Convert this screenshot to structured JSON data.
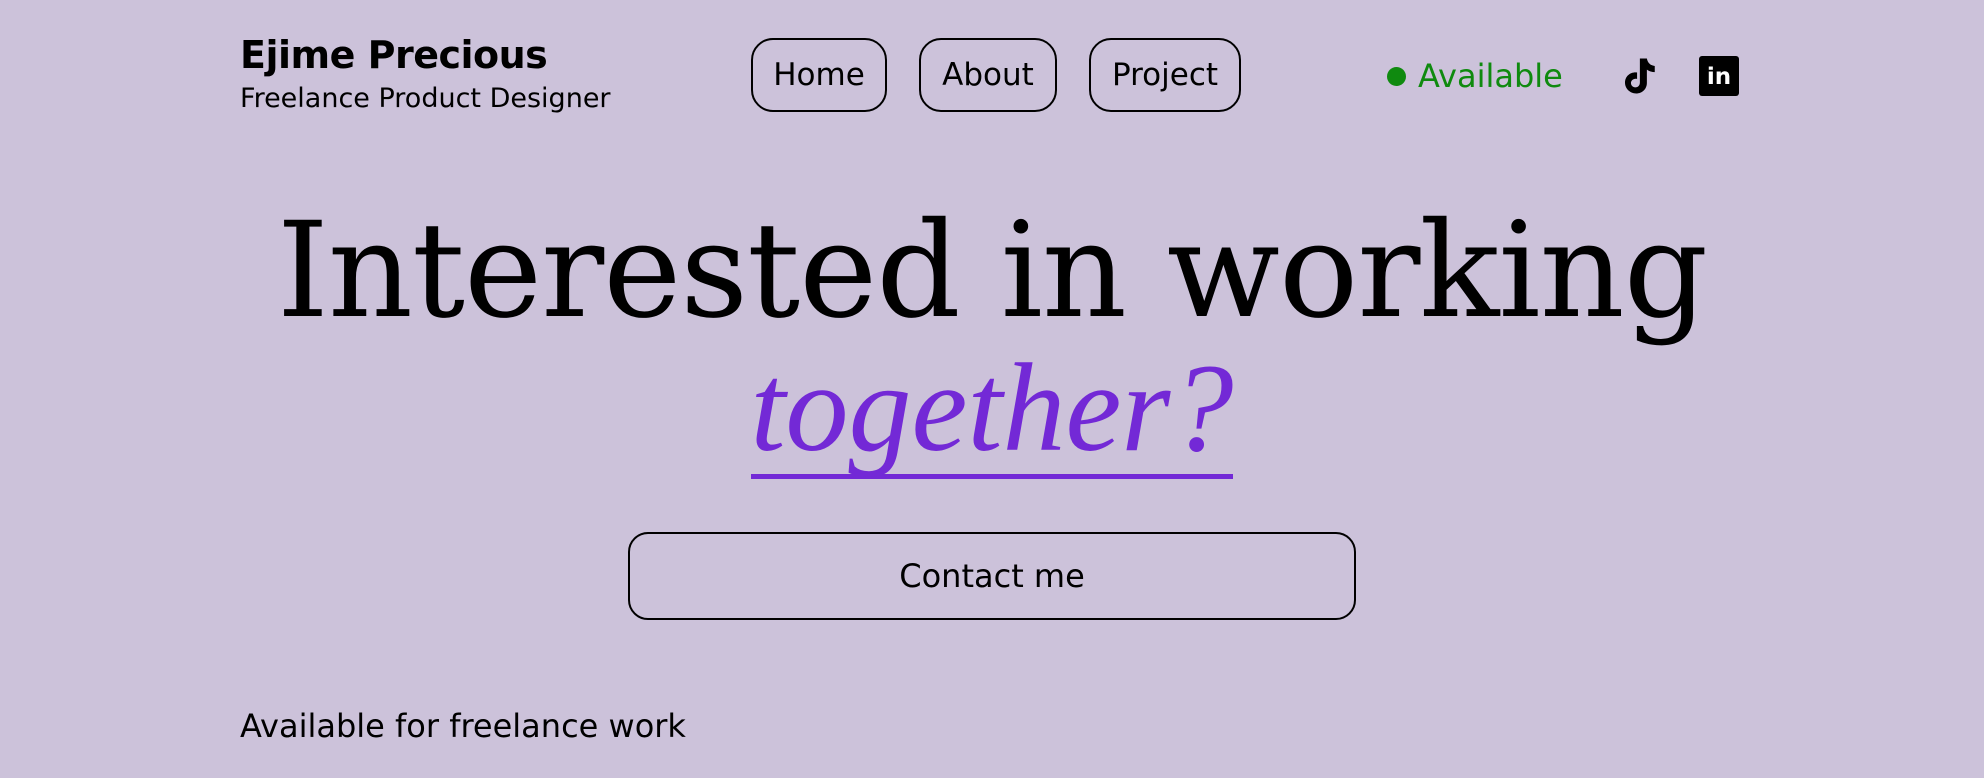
{
  "header": {
    "name": "Ejime Precious",
    "title": "Freelance Product Designer"
  },
  "nav": {
    "items": [
      "Home",
      "About",
      "Project"
    ]
  },
  "status": {
    "label": "Available",
    "color": "#0f8a0f"
  },
  "socials": [
    {
      "icon": "tiktok-icon"
    },
    {
      "icon": "linkedin-icon",
      "text": "in"
    }
  ],
  "hero": {
    "line1": "Interested in working",
    "line2": "together?",
    "accent_color": "#7329d6"
  },
  "cta": {
    "label": "Contact me"
  },
  "footer": {
    "note": "Available for freelance work"
  },
  "colors": {
    "background": "#ccc2da",
    "text": "#000000"
  }
}
